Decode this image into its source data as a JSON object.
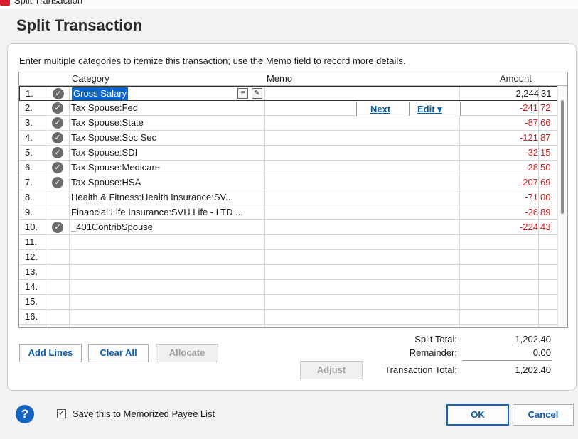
{
  "window": {
    "title": "Split Transaction"
  },
  "dialog": {
    "title": "Split Transaction",
    "instructions": "Enter multiple categories to itemize this transaction; use the Memo field to record more details."
  },
  "grid": {
    "headers": {
      "category": "Category",
      "memo": "Memo",
      "amount": "Amount"
    },
    "row_actions": {
      "next": "Next",
      "edit": "Edit ▾"
    },
    "rows": [
      {
        "num": "1.",
        "checked": true,
        "category": "Gross Salary",
        "amount": "2,244",
        "cents": "31",
        "negative": false,
        "selected": true
      },
      {
        "num": "2.",
        "checked": true,
        "category": "Tax Spouse:Fed",
        "amount": "-241",
        "cents": "72",
        "negative": true
      },
      {
        "num": "3.",
        "checked": true,
        "category": "Tax Spouse:State",
        "amount": "-87",
        "cents": "66",
        "negative": true
      },
      {
        "num": "4.",
        "checked": true,
        "category": "Tax Spouse:Soc Sec",
        "amount": "-121",
        "cents": "87",
        "negative": true
      },
      {
        "num": "5.",
        "checked": true,
        "category": "Tax Spouse:SDI",
        "amount": "-32",
        "cents": "15",
        "negative": true
      },
      {
        "num": "6.",
        "checked": true,
        "category": "Tax Spouse:Medicare",
        "amount": "-28",
        "cents": "50",
        "negative": true
      },
      {
        "num": "7.",
        "checked": true,
        "category": "Tax Spouse:HSA",
        "amount": "-207",
        "cents": "69",
        "negative": true
      },
      {
        "num": "8.",
        "checked": false,
        "category": "Health & Fitness:Health Insurance:SV...",
        "amount": "-71",
        "cents": "00",
        "negative": true
      },
      {
        "num": "9.",
        "checked": false,
        "category": "Financial:Life Insurance:SVH Life - LTD ...",
        "amount": "-26",
        "cents": "89",
        "negative": true
      },
      {
        "num": "10.",
        "checked": true,
        "category": "_401ContribSpouse",
        "amount": "-224",
        "cents": "43",
        "negative": true
      },
      {
        "num": "11.",
        "checked": false,
        "category": "",
        "amount": "",
        "cents": ""
      },
      {
        "num": "12.",
        "checked": false,
        "category": "",
        "amount": "",
        "cents": ""
      },
      {
        "num": "13.",
        "checked": false,
        "category": "",
        "amount": "",
        "cents": ""
      },
      {
        "num": "14.",
        "checked": false,
        "category": "",
        "amount": "",
        "cents": ""
      },
      {
        "num": "15.",
        "checked": false,
        "category": "",
        "amount": "",
        "cents": ""
      },
      {
        "num": "16.",
        "checked": false,
        "category": "",
        "amount": "",
        "cents": ""
      }
    ]
  },
  "buttons": {
    "add_lines": "Add Lines",
    "clear_all": "Clear All",
    "allocate": "Allocate",
    "adjust": "Adjust",
    "ok": "OK",
    "cancel": "Cancel"
  },
  "summary": {
    "split_total_label": "Split Total:",
    "split_total": "1,202.40",
    "remainder_label": "Remainder:",
    "remainder": "0.00",
    "transaction_total_label": "Transaction Total:",
    "transaction_total": "1,202.40"
  },
  "footer": {
    "help": "?",
    "memorize_label": "Save this to Memorized Payee List",
    "memorize_checked": true
  },
  "colors": {
    "accent": "#1565c0",
    "negative": "#d42020",
    "selection": "#0b66d0"
  },
  "icons": [
    "app-icon",
    "check-circle-icon",
    "help-icon",
    "checkbox-icon",
    "calendar-icon",
    "memo-icon"
  ]
}
